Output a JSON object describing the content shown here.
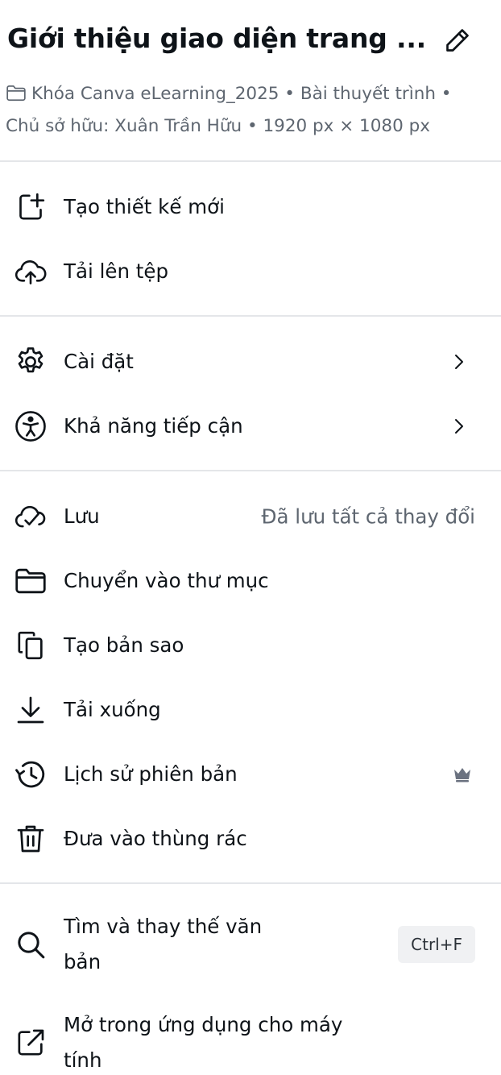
{
  "header": {
    "title": "Giới thiệu giao diện trang ...",
    "meta_line1": "Khóa Canva eLearning_2025 • Bài thuyết trình •",
    "meta_line2": "Chủ sở hữu: Xuân Trần Hữu • 1920 px × 1080 px"
  },
  "menu": {
    "create_new": "Tạo thiết kế mới",
    "upload": "Tải lên tệp",
    "settings": "Cài đặt",
    "accessibility": "Khả năng tiếp cận",
    "save": "Lưu",
    "save_status": "Đã lưu tất cả thay đổi",
    "move_folder": "Chuyển vào thư mục",
    "duplicate": "Tạo bản sao",
    "download": "Tải xuống",
    "version_history": "Lịch sử phiên bản",
    "trash": "Đưa vào thùng rác",
    "find_replace": "Tìm và thay thế văn bản",
    "find_shortcut": "Ctrl+F",
    "open_desktop": "Mở trong ứng dụng cho máy tính"
  },
  "icons": {
    "edit": "pencil-icon",
    "folder": "folder-icon",
    "create": "add-design-icon",
    "upload": "cloud-upload-icon",
    "settings": "gear-icon",
    "accessibility": "accessibility-icon",
    "save": "cloud-check-icon",
    "move": "folder-icon",
    "duplicate": "copy-icon",
    "download": "download-icon",
    "history": "history-icon",
    "trash": "trash-icon",
    "search": "search-icon",
    "open_external": "open-external-icon",
    "premium": "crown-icon",
    "chevron": "chevron-right-icon"
  },
  "colors": {
    "text": "#0e1318",
    "secondary_text": "#5e6670",
    "divider": "#e4e6e9",
    "shortcut_bg": "#f0f1f3"
  }
}
